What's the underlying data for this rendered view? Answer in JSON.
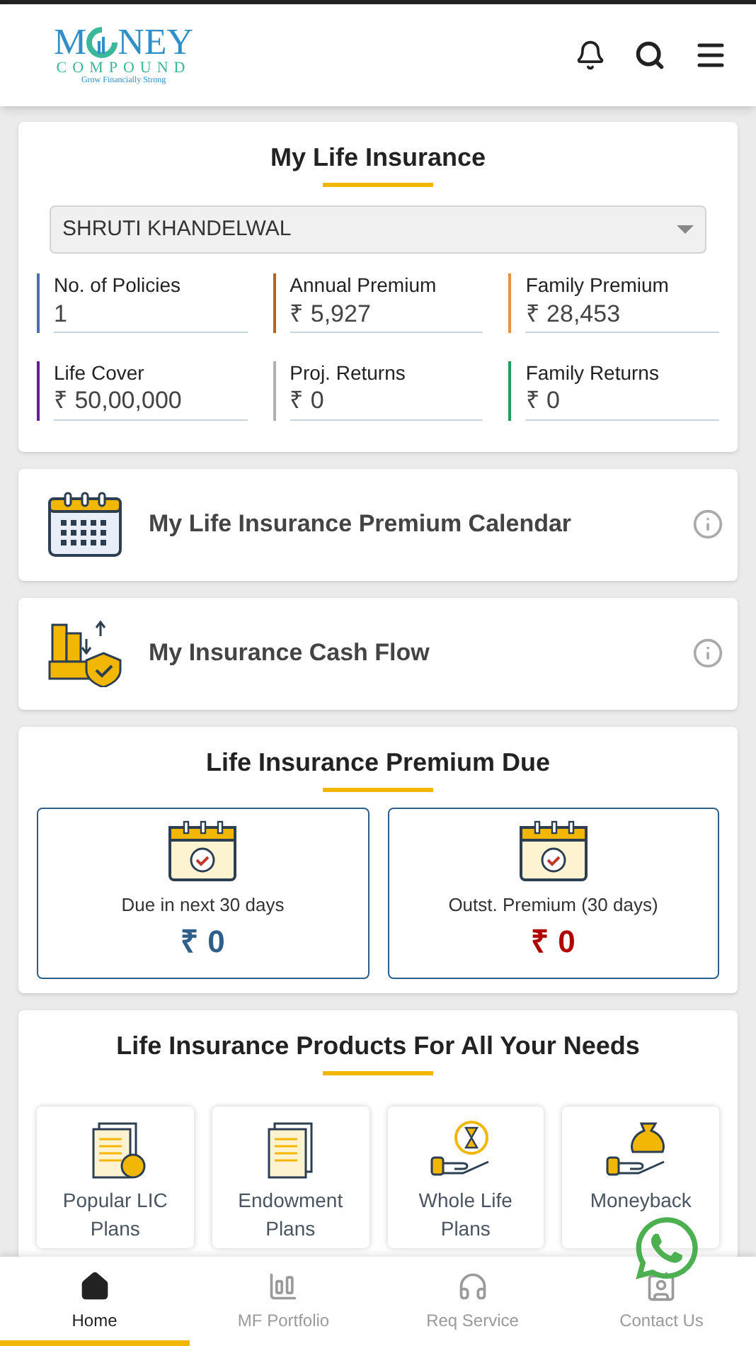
{
  "header": {
    "logo": {
      "part1": "M",
      "part2": "NEY",
      "line2": "COMPOUND",
      "tagline": "Grow Financially Strong"
    }
  },
  "summary": {
    "title": "My Life Insurance",
    "member_select": {
      "value": "SHRUTI KHANDELWAL"
    },
    "stats": [
      {
        "label": "No. of Policies",
        "value": "1",
        "color": "#4a6fb5"
      },
      {
        "label": "Annual Premium",
        "value": "₹ 5,927",
        "color": "#b5651d"
      },
      {
        "label": "Family Premium",
        "value": "₹ 28,453",
        "color": "#e0954a"
      },
      {
        "label": "Life Cover",
        "value": "₹ 50,00,000",
        "color": "#6a1b9a"
      },
      {
        "label": "Proj. Returns",
        "value": "₹ 0",
        "color": "#b0b0b0"
      },
      {
        "label": "Family Returns",
        "value": "₹ 0",
        "color": "#1e9e5a"
      }
    ]
  },
  "links": [
    {
      "kind": "calendar",
      "title": "My Life Insurance Premium Calendar"
    },
    {
      "kind": "cashflow",
      "title": "My Insurance Cash Flow"
    }
  ],
  "premium_due": {
    "title": "Life Insurance Premium Due",
    "boxes": [
      {
        "label": "Due in next 30 days",
        "value": "₹ 0",
        "color": "#2e5f8a"
      },
      {
        "label": "Outst. Premium (30 days)",
        "value": "₹ 0",
        "color": "#b00000"
      }
    ]
  },
  "products": {
    "title": "Life Insurance Products For All Your Needs",
    "items": [
      {
        "kind": "docs-thumb",
        "label": "Popular LIC Plans"
      },
      {
        "kind": "docs",
        "label": "Endowment Plans"
      },
      {
        "kind": "hourglass",
        "label": "Whole Life Plans"
      },
      {
        "kind": "moneybag",
        "label": "Moneyback"
      }
    ]
  },
  "bottom_nav": [
    {
      "kind": "home",
      "label": "Home",
      "selected": true
    },
    {
      "kind": "chart",
      "label": "MF Portfolio",
      "selected": false
    },
    {
      "kind": "headset",
      "label": "Req Service",
      "selected": false
    },
    {
      "kind": "contact",
      "label": "Contact Us",
      "selected": false
    }
  ]
}
